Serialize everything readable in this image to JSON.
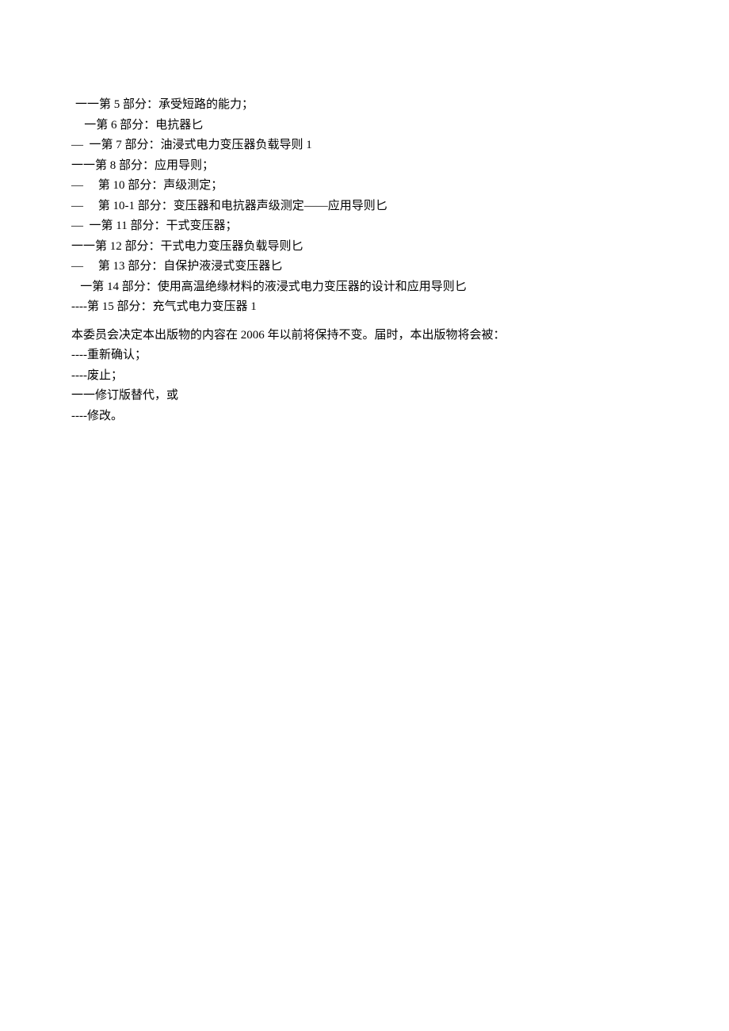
{
  "parts": [
    {
      "text": "一一第 5 部分：承受短路的能力；",
      "indent": ""
    },
    {
      "text": "   一第 6 部分：电抗器匕",
      "indent": ""
    },
    {
      "text": "—  一第 7 部分：油浸式电力变压器负载导则 1",
      "indent": "indent-neg"
    },
    {
      "text": "一一第 8 部分：应用导则；",
      "indent": "indent-neg"
    },
    {
      "text": "—     第 10 部分：声级测定；",
      "indent": "indent-neg"
    },
    {
      "text": "—     第 10-1 部分：变压器和电抗器声级测定——应用导则匕",
      "indent": "indent-neg"
    },
    {
      "text": "—  一第 11 部分：干式变压器；",
      "indent": "indent-neg"
    },
    {
      "text": "一一第 12 部分：干式电力变压器负载导则匕",
      "indent": "indent-neg"
    },
    {
      "text": "—     第 13 部分：自保护液浸式变压器匕",
      "indent": "indent-neg"
    },
    {
      "text": "   一第 14 部分：使用高温绝缘材料的液浸式电力变压器的设计和应用导则匕",
      "indent": "indent-neg"
    },
    {
      "text": "----第 15 部分：充气式电力变压器 1",
      "indent": "indent-neg"
    }
  ],
  "paragraph": "本委员会决定本出版物的内容在 2006 年以前将保持不变。届时，本出版物将会被：",
  "outcomes": [
    "----重新确认；",
    "----废止；",
    "一一修订版替代，或",
    "----修改。"
  ]
}
